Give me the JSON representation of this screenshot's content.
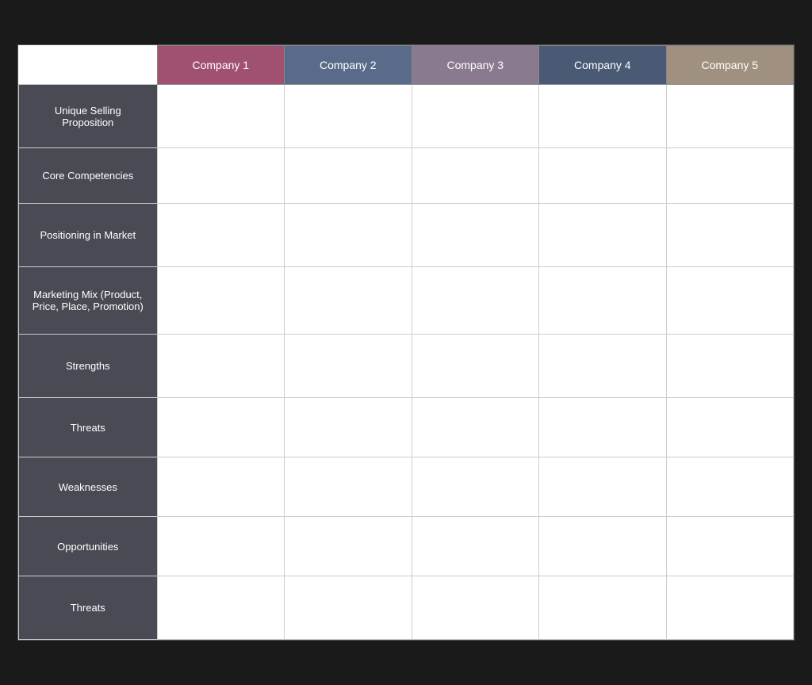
{
  "header": {
    "empty_label": "",
    "companies": [
      {
        "label": "Company 1",
        "class": "col-company1"
      },
      {
        "label": "Company 2",
        "class": "col-company2"
      },
      {
        "label": "Company 3",
        "class": "col-company3"
      },
      {
        "label": "Company 4",
        "class": "col-company4"
      },
      {
        "label": "Company 5",
        "class": "col-company5"
      }
    ]
  },
  "rows": [
    {
      "label": "Unique Selling Proposition",
      "class": "row-usp"
    },
    {
      "label": "Core Competencies",
      "class": "row-core"
    },
    {
      "label": "Positioning in Market",
      "class": "row-positioning"
    },
    {
      "label": "Marketing Mix (Product, Price, Place, Promotion)",
      "class": "row-marketing"
    },
    {
      "label": "Strengths",
      "class": "row-strengths"
    },
    {
      "label": "Threats",
      "class": "row-threats1"
    },
    {
      "label": "Weaknesses",
      "class": "row-weaknesses"
    },
    {
      "label": "Opportunities",
      "class": "row-opportunities"
    },
    {
      "label": "Threats",
      "class": "row-threats2"
    }
  ]
}
